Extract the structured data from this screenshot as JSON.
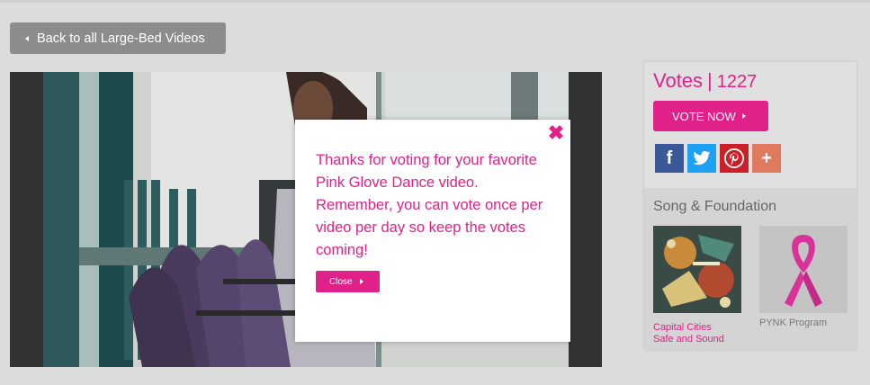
{
  "nav": {
    "back_label": "Back to all Large-Bed Videos"
  },
  "video": {
    "popup": {
      "close_icon": "close-x-icon",
      "message": "Thanks for voting for your favorite Pink Glove Dance video. Remember, you can vote once per video per day so keep the votes coming!",
      "close_label": "Close"
    }
  },
  "votes": {
    "label": "Votes",
    "separator": "|",
    "count": "1227",
    "vote_button": "VOTE NOW"
  },
  "social": [
    {
      "name": "facebook-icon",
      "glyph": "f"
    },
    {
      "name": "twitter-icon",
      "glyph": "t"
    },
    {
      "name": "pinterest-icon",
      "glyph": "p"
    },
    {
      "name": "share-plus-icon",
      "glyph": "+"
    }
  ],
  "song": {
    "title": "Song & Foundation",
    "cards": [
      {
        "line1": "Capital Cities",
        "line2": "Safe and Sound"
      },
      {
        "line1": "PYNK Program",
        "line2": ""
      }
    ]
  },
  "colors": {
    "accent": "#e0218a",
    "button_gray": "#8c8c8c",
    "background": "#dcdcdc"
  }
}
